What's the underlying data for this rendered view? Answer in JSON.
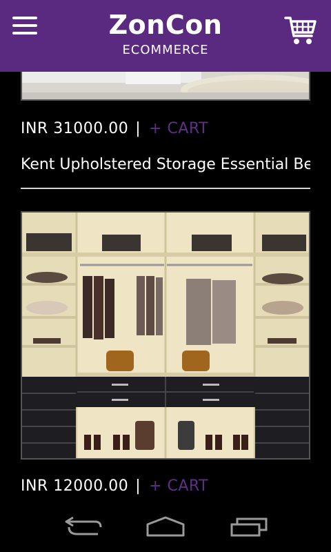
{
  "appbar": {
    "brand_name": "ZonCon",
    "brand_sub": "ECOMMERCE",
    "menu_icon": "hamburger-menu-icon",
    "cart_icon": "shopping-cart-icon"
  },
  "products": [
    {
      "price": "INR 31000.00",
      "separator": "|",
      "cart_label": "+ CART",
      "title": "Kent Upholstered Storage Essential Be"
    },
    {
      "price": "INR 12000.00",
      "separator": "|",
      "cart_label": "+ CART"
    }
  ],
  "navbar": {
    "back_icon": "back-icon",
    "home_icon": "home-icon",
    "recents_icon": "recent-apps-icon"
  },
  "colors": {
    "appbar": "#5a2a80",
    "cart_link": "#5e3187"
  }
}
